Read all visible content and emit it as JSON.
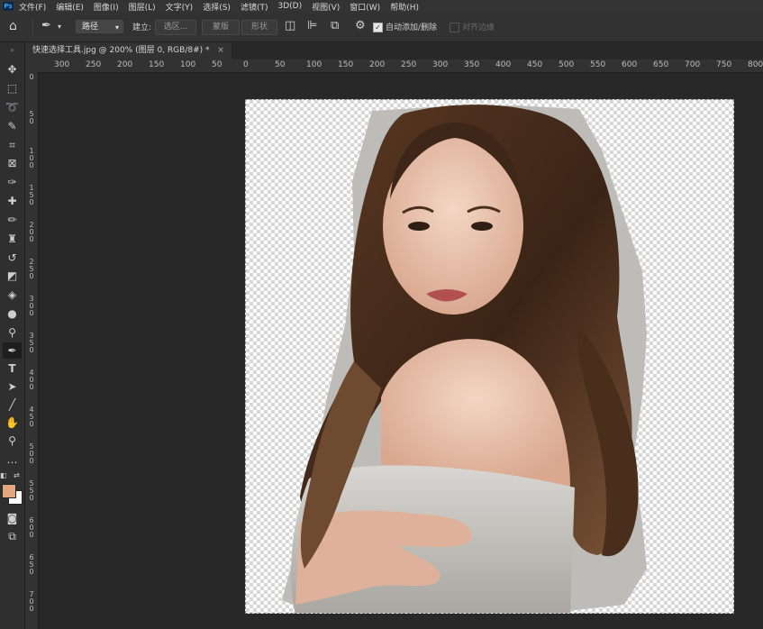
{
  "app": {
    "logo": "Ps"
  },
  "menu": [
    "文件(F)",
    "编辑(E)",
    "图像(I)",
    "图层(L)",
    "文字(Y)",
    "选择(S)",
    "滤镜(T)",
    "3D(D)",
    "视图(V)",
    "窗口(W)",
    "帮助(H)"
  ],
  "options": {
    "mode_value": "路径",
    "make_label": "建立:",
    "selection_btn": "选区...",
    "mask_btn": "蒙版",
    "shape_btn": "形状",
    "auto_add_delete_label": "自动添加/删除",
    "align_edges_label": "对齐边缘",
    "auto_add_delete_checked": true,
    "align_edges_checked": false
  },
  "document": {
    "tab_title": "快速选择工具.jpg @ 200% (图层 0, RGB/8#) *",
    "close_glyph": "×"
  },
  "ruler": {
    "horizontal": [
      "300",
      "250",
      "200",
      "150",
      "100",
      "50",
      "0",
      "50",
      "100",
      "150",
      "200",
      "250",
      "300",
      "350",
      "400",
      "450",
      "500",
      "550",
      "600",
      "650",
      "700",
      "750",
      "800"
    ],
    "vertical": [
      [
        "0"
      ],
      [
        "5",
        "0"
      ],
      [
        "1",
        "0",
        "0"
      ],
      [
        "1",
        "5",
        "0"
      ],
      [
        "2",
        "0",
        "0"
      ],
      [
        "2",
        "5",
        "0"
      ],
      [
        "3",
        "0",
        "0"
      ],
      [
        "3",
        "5",
        "0"
      ],
      [
        "4",
        "0",
        "0"
      ],
      [
        "4",
        "5",
        "0"
      ],
      [
        "5",
        "0",
        "0"
      ],
      [
        "5",
        "5",
        "0"
      ],
      [
        "6",
        "0",
        "0"
      ],
      [
        "6",
        "5",
        "0"
      ],
      [
        "7",
        "0",
        "0"
      ]
    ]
  },
  "colors": {
    "foreground": "#e2a77e",
    "background": "#ffffff",
    "accent": "#35a3ff"
  },
  "icons": [
    "home-icon",
    "pen-tool-icon",
    "chevron-down-icon",
    "path-operations-icon",
    "path-alignment-icon",
    "path-arrangement-icon",
    "gear-icon",
    "move-icon",
    "marquee-icon",
    "lasso-icon",
    "quick-selection-icon",
    "crop-icon",
    "frame-icon",
    "eyedropper-icon",
    "healing-brush-icon",
    "brush-icon",
    "clone-stamp-icon",
    "history-brush-icon",
    "eraser-icon",
    "paint-bucket-icon",
    "blur-icon",
    "dodge-icon",
    "pen-icon",
    "type-icon",
    "path-selection-icon",
    "line-icon",
    "hand-icon",
    "zoom-icon",
    "more-tools-icon",
    "quick-mask-icon",
    "screen-mode-icon"
  ]
}
